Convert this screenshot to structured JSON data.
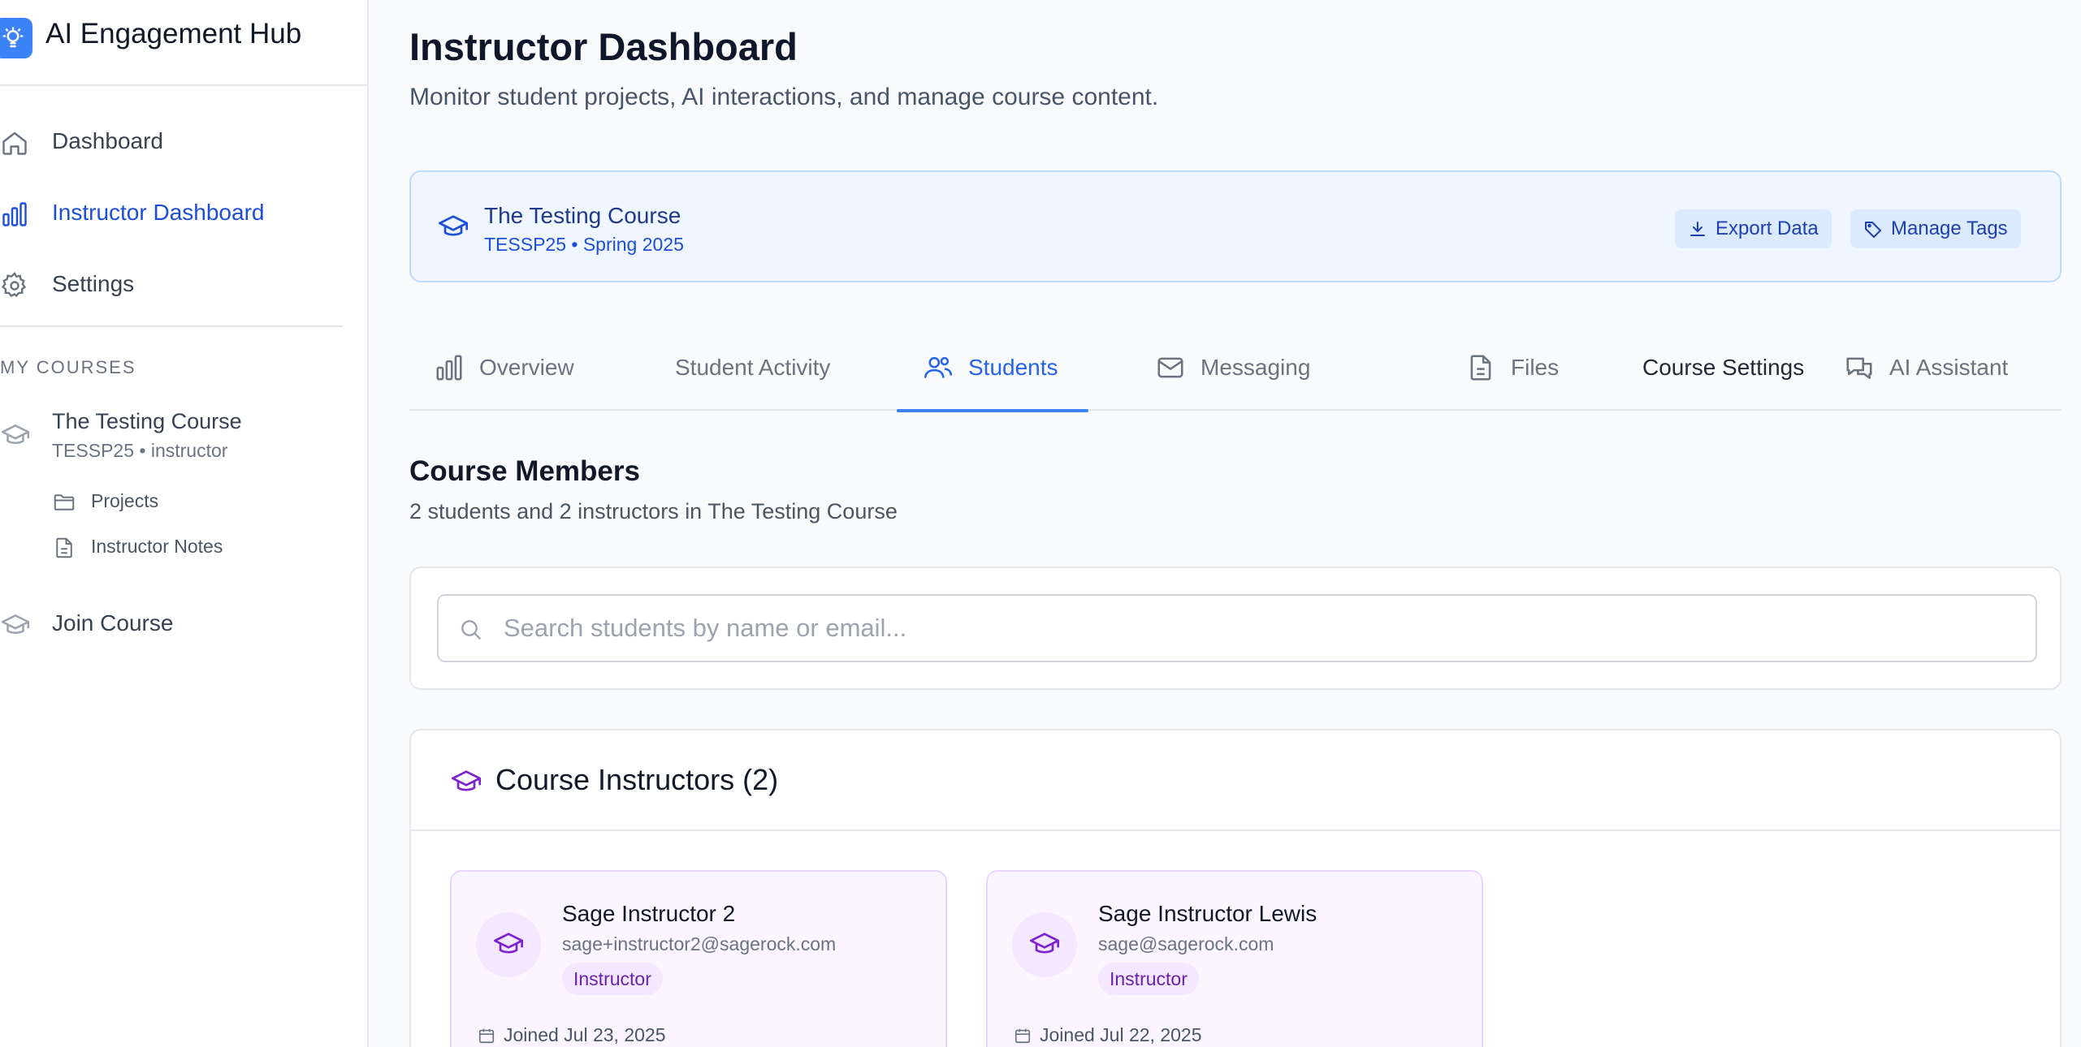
{
  "app": {
    "title": "AI Engagement Hub"
  },
  "sidebar": {
    "nav": [
      {
        "label": "Dashboard",
        "icon": "home-icon"
      },
      {
        "label": "Instructor Dashboard",
        "icon": "bar-chart-icon",
        "active": true
      },
      {
        "label": "Settings",
        "icon": "gear-icon"
      }
    ],
    "section_label": "MY COURSES",
    "course": {
      "name": "The Testing Course",
      "meta": "TESSP25 • instructor"
    },
    "sub_items": [
      {
        "label": "Projects",
        "icon": "folder-icon"
      },
      {
        "label": "Instructor Notes",
        "icon": "file-icon"
      }
    ],
    "join_label": "Join Course"
  },
  "header": {
    "title": "Instructor Dashboard",
    "subtitle": "Monitor student projects, AI interactions, and manage course content."
  },
  "banner": {
    "course_name": "The Testing Course",
    "course_meta": "TESSP25 • Spring 2025",
    "export_label": "Export Data",
    "tags_label": "Manage Tags"
  },
  "tabs": [
    {
      "label": "Overview",
      "icon": "bar-chart-icon"
    },
    {
      "label": "Student Activity",
      "icon": ""
    },
    {
      "label": "Students",
      "icon": "users-icon",
      "active": true
    },
    {
      "label": "Messaging",
      "icon": "mail-icon"
    },
    {
      "label": "Files",
      "icon": "file-icon"
    },
    {
      "label": "Course Settings",
      "icon": ""
    },
    {
      "label": "AI Assistant",
      "icon": "chat-icon"
    }
  ],
  "members": {
    "title": "Course Members",
    "subtitle": "2 students and 2 instructors in The Testing Course"
  },
  "search": {
    "placeholder": "Search students by name or email...",
    "value": ""
  },
  "instructors": {
    "title": "Course Instructors (2)",
    "list": [
      {
        "name": "Sage Instructor 2",
        "email": "sage+instructor2@sagerock.com",
        "role": "Instructor",
        "joined": "Joined Jul 23, 2025"
      },
      {
        "name": "Sage Instructor Lewis",
        "email": "sage@sagerock.com",
        "role": "Instructor",
        "joined": "Joined Jul 22, 2025"
      }
    ]
  },
  "colors": {
    "accent": "#2563eb",
    "banner_bg": "#eff6ff",
    "instructor_purple": "#7e22ce",
    "brand_logo": "#3b82f6"
  }
}
